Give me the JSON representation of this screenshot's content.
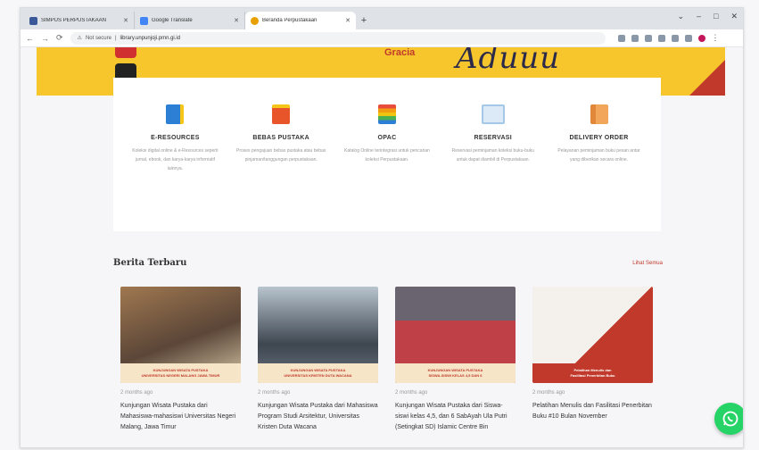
{
  "browser": {
    "tabs": [
      {
        "title": "SIMPUS PERPUSTAKAAN",
        "favicon_color": "#3b5998",
        "active": false
      },
      {
        "title": "Google Translate",
        "favicon_color": "#4285f4",
        "active": false
      },
      {
        "title": "Beranda Perpustakaan",
        "favicon_color": "#e8a000",
        "active": true
      }
    ],
    "new_tab": "+",
    "window_controls": {
      "minimize": "–",
      "maximize": "□",
      "close": "✕",
      "tablist": "⌄"
    },
    "nav": {
      "back": "←",
      "forward": "→",
      "reload": "⟳"
    },
    "address": {
      "security": "Not secure",
      "url": "library.unpunjoji.pmn.gi.id"
    }
  },
  "hero": {
    "text": "Aduuu",
    "logo": "Gracia"
  },
  "services": [
    {
      "title": "E-RESOURCES",
      "desc": "Koleksi digital online & e-Resources seperti jurnal, ebook, dan karya-karya informatif lainnya.",
      "color": "#2d7fd6"
    },
    {
      "title": "BEBAS PUSTAKA",
      "desc": "Proses pengajuan bebas pustaka atau bebas pinjaman/tanggungan perpustakaan.",
      "color": "#e8552a"
    },
    {
      "title": "OPAC",
      "desc": "Katalog Online terintegrasi untuk pencarian koleksi Perpustakaan.",
      "color": "#4caf50"
    },
    {
      "title": "RESERVASI",
      "desc": "Reservasi peminjaman koleksi buku-buku untuk dapat diambil di Perpustakaan.",
      "color": "#a6c8e8"
    },
    {
      "title": "DELIVERY ORDER",
      "desc": "Pelayanan peminjaman buku pesan antar yang diberikan secara online.",
      "color": "#f2a65a"
    }
  ],
  "news": {
    "title": "Berita Terbaru",
    "view_all": "Lihat Semua",
    "items": [
      {
        "date": "2 months ago",
        "text": "Kunjungan Wisata Pustaka dari Mahasiswa-mahasiswi Universitas Negeri Malang, Jawa Timur",
        "strip": [
          "KUNJUNGAN WISATA PUSTAKA",
          "UNIVERSITAS NEGERI MALANG JAWA TIMUR"
        ],
        "img": [
          "#a07850",
          "#5b4638"
        ]
      },
      {
        "date": "2 months ago",
        "text": "Kunjungan Wisata Pustaka dari Mahasiswa Program Studi Arsitektur, Universitas Kristen Duta Wacana",
        "strip": [
          "KUNJUNGAN WISATA PUSTAKA",
          "UNIVERSITAS KRISTEN DUTA WACANA"
        ],
        "img": [
          "#8a9aa8",
          "#3e4650"
        ]
      },
      {
        "date": "2 months ago",
        "text": "Kunjungan Wisata Pustaka dari Siswa-siswi kelas 4,5, dan 6 SabAyah Ula Putri (Setingkat SD) Islamic Centre Bin",
        "strip": [
          "KUNJUNGAN WISATA PUSTAKA",
          "SISWA-SISWI KELAS 4,5 DAN 6"
        ],
        "img": [
          "#c04048",
          "#6a6470"
        ]
      },
      {
        "date": "2 months ago",
        "text": "Pelatihan Menulis dan Fasilitasi Penerbitan Buku #10 Bulan November",
        "strip": [
          "Pelatihan Menulis dan",
          "Fasilitasi Penerbitan Buku"
        ],
        "img": [
          "#e8e4e0",
          "#c0392b"
        ]
      }
    ]
  }
}
